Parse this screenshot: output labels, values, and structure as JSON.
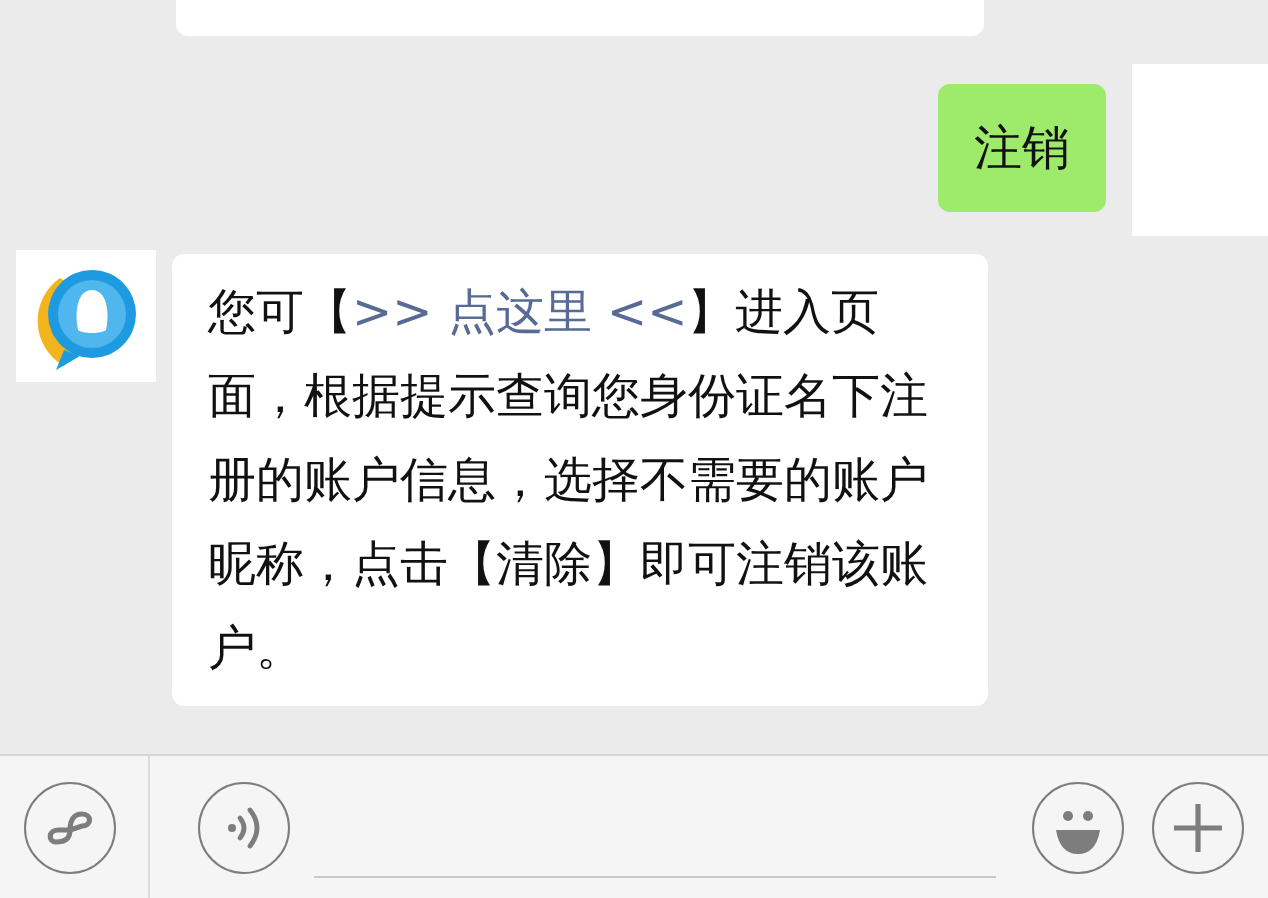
{
  "messages": [
    {
      "kind": "outgoing",
      "segments": [
        {
          "kind": "text",
          "text": "注销"
        }
      ]
    },
    {
      "kind": "incoming",
      "segments": [
        {
          "kind": "text",
          "text": "您可【"
        },
        {
          "kind": "link",
          "text": ">> 点这里 <<"
        },
        {
          "kind": "text",
          "text": "】进入页面，根据提示查询您身份证名下注册的账户信息，选择不需要的账户昵称，点击【清除】即可注销该账户。"
        }
      ]
    }
  ]
}
